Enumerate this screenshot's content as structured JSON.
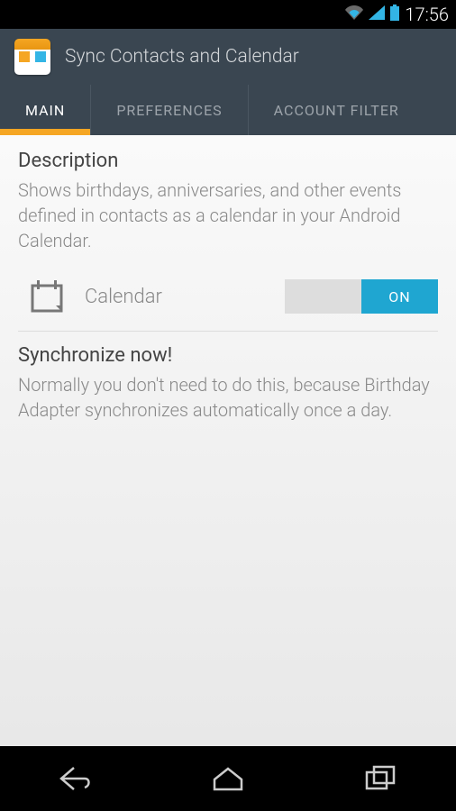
{
  "statusBar": {
    "time": "17:56"
  },
  "actionBar": {
    "title": "Sync Contacts and Calendar"
  },
  "tabs": {
    "main": "MAIN",
    "preferences": "PREFERENCES",
    "accountFilter": "ACCOUNT FILTER"
  },
  "description": {
    "title": "Description",
    "text": "Shows birthdays, anniversaries, and other events defined in contacts as a calendar in your Android Calendar."
  },
  "calendar": {
    "label": "Calendar",
    "toggleState": "ON"
  },
  "sync": {
    "title": "Synchronize now!",
    "text": "Normally you don't need to do this, because Birthday Adapter synchronizes automatically once a day."
  }
}
